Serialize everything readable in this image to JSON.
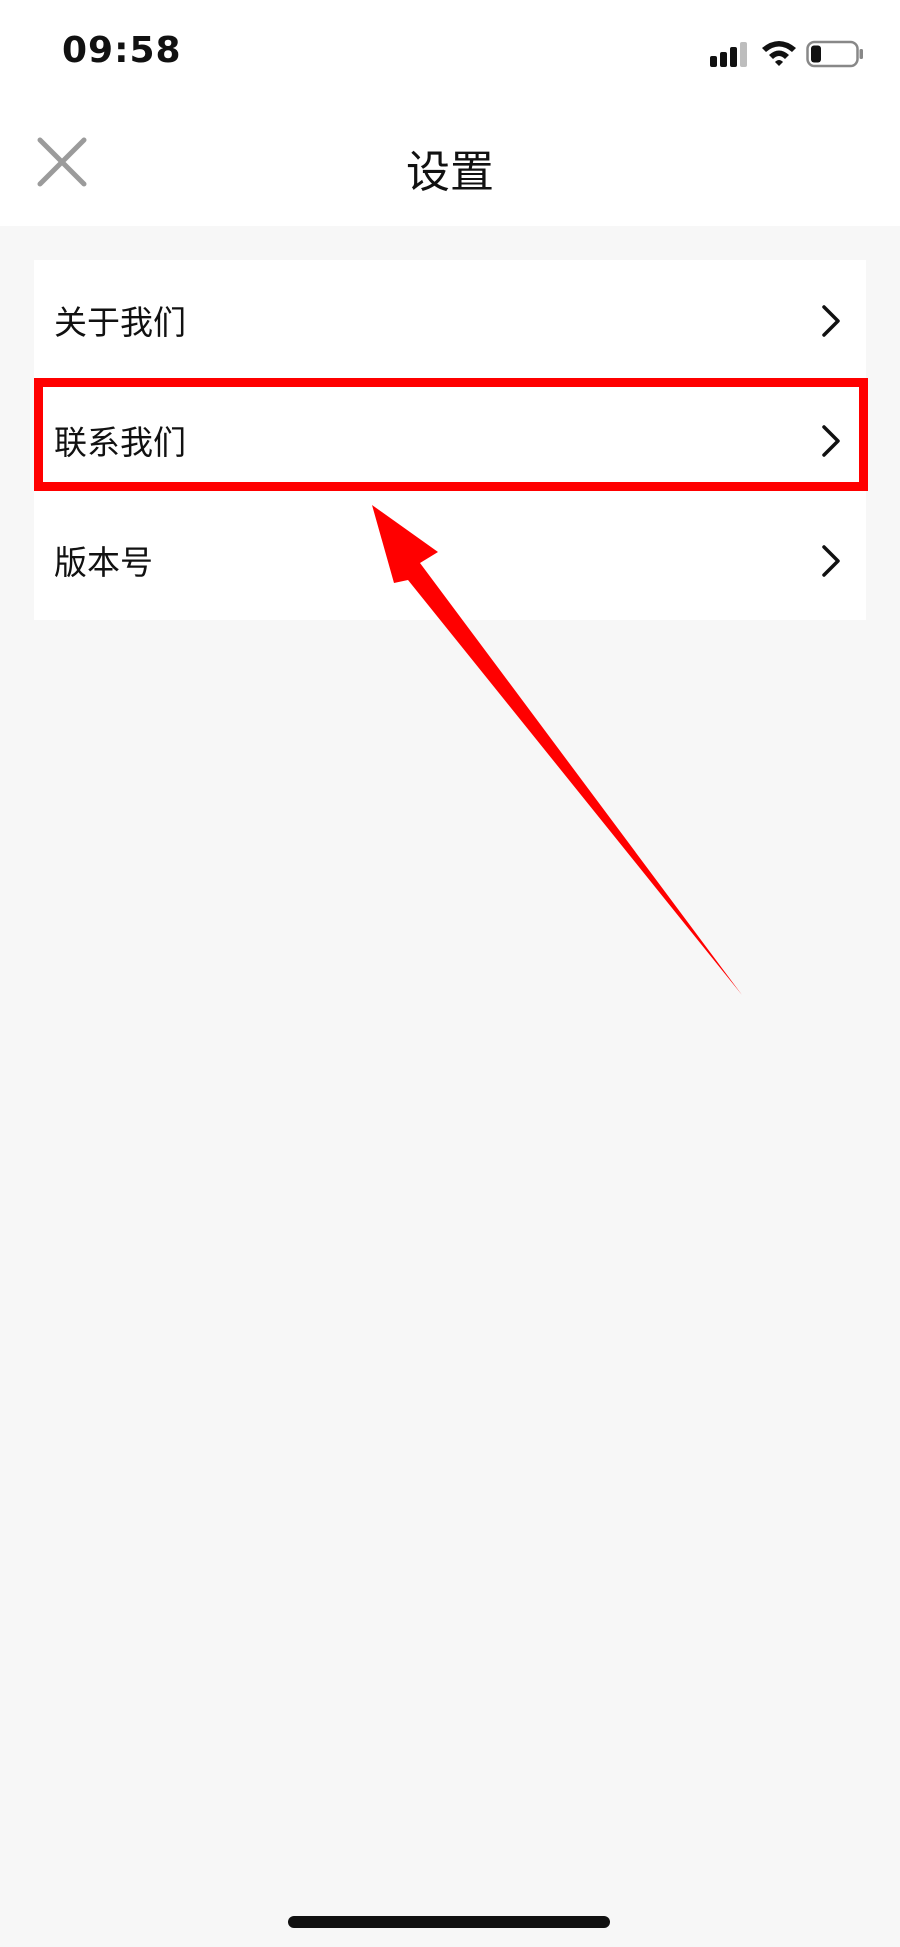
{
  "status_bar": {
    "time": "09:58",
    "icons": [
      "signal-icon",
      "wifi-icon",
      "battery-icon"
    ]
  },
  "nav": {
    "title": "设置",
    "close_icon": "close-icon"
  },
  "settings": {
    "items": [
      {
        "label": "关于我们"
      },
      {
        "label": "联系我们"
      },
      {
        "label": "版本号"
      }
    ]
  },
  "colors": {
    "highlight": "#ff0000",
    "background": "#f7f7f7",
    "card": "#ffffff",
    "close_icon": "#9b9b9b"
  },
  "annotation": {
    "highlighted_item": "联系我们"
  }
}
